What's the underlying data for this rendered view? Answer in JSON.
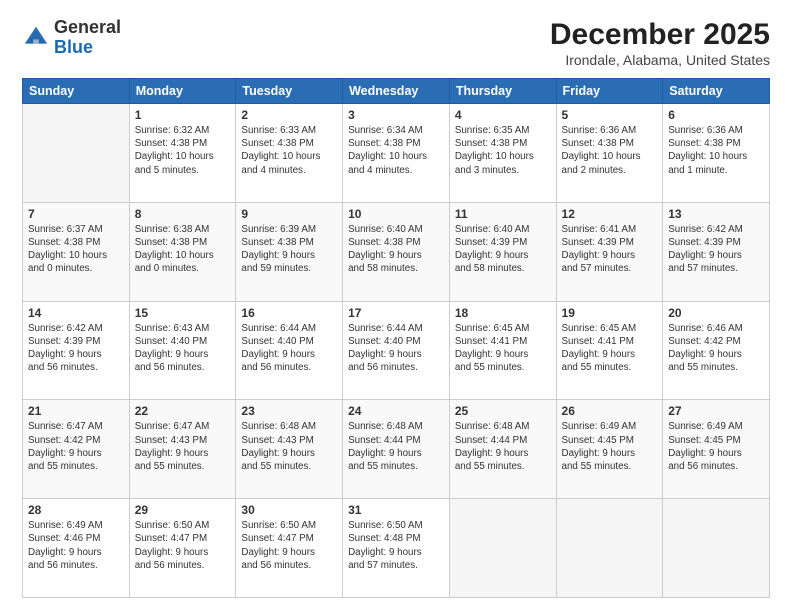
{
  "header": {
    "logo_general": "General",
    "logo_blue": "Blue",
    "title": "December 2025",
    "subtitle": "Irondale, Alabama, United States"
  },
  "weekdays": [
    "Sunday",
    "Monday",
    "Tuesday",
    "Wednesday",
    "Thursday",
    "Friday",
    "Saturday"
  ],
  "weeks": [
    [
      {
        "day": "",
        "detail": ""
      },
      {
        "day": "1",
        "detail": "Sunrise: 6:32 AM\nSunset: 4:38 PM\nDaylight: 10 hours\nand 5 minutes."
      },
      {
        "day": "2",
        "detail": "Sunrise: 6:33 AM\nSunset: 4:38 PM\nDaylight: 10 hours\nand 4 minutes."
      },
      {
        "day": "3",
        "detail": "Sunrise: 6:34 AM\nSunset: 4:38 PM\nDaylight: 10 hours\nand 4 minutes."
      },
      {
        "day": "4",
        "detail": "Sunrise: 6:35 AM\nSunset: 4:38 PM\nDaylight: 10 hours\nand 3 minutes."
      },
      {
        "day": "5",
        "detail": "Sunrise: 6:36 AM\nSunset: 4:38 PM\nDaylight: 10 hours\nand 2 minutes."
      },
      {
        "day": "6",
        "detail": "Sunrise: 6:36 AM\nSunset: 4:38 PM\nDaylight: 10 hours\nand 1 minute."
      }
    ],
    [
      {
        "day": "7",
        "detail": "Sunrise: 6:37 AM\nSunset: 4:38 PM\nDaylight: 10 hours\nand 0 minutes."
      },
      {
        "day": "8",
        "detail": "Sunrise: 6:38 AM\nSunset: 4:38 PM\nDaylight: 10 hours\nand 0 minutes."
      },
      {
        "day": "9",
        "detail": "Sunrise: 6:39 AM\nSunset: 4:38 PM\nDaylight: 9 hours\nand 59 minutes."
      },
      {
        "day": "10",
        "detail": "Sunrise: 6:40 AM\nSunset: 4:38 PM\nDaylight: 9 hours\nand 58 minutes."
      },
      {
        "day": "11",
        "detail": "Sunrise: 6:40 AM\nSunset: 4:39 PM\nDaylight: 9 hours\nand 58 minutes."
      },
      {
        "day": "12",
        "detail": "Sunrise: 6:41 AM\nSunset: 4:39 PM\nDaylight: 9 hours\nand 57 minutes."
      },
      {
        "day": "13",
        "detail": "Sunrise: 6:42 AM\nSunset: 4:39 PM\nDaylight: 9 hours\nand 57 minutes."
      }
    ],
    [
      {
        "day": "14",
        "detail": "Sunrise: 6:42 AM\nSunset: 4:39 PM\nDaylight: 9 hours\nand 56 minutes."
      },
      {
        "day": "15",
        "detail": "Sunrise: 6:43 AM\nSunset: 4:40 PM\nDaylight: 9 hours\nand 56 minutes."
      },
      {
        "day": "16",
        "detail": "Sunrise: 6:44 AM\nSunset: 4:40 PM\nDaylight: 9 hours\nand 56 minutes."
      },
      {
        "day": "17",
        "detail": "Sunrise: 6:44 AM\nSunset: 4:40 PM\nDaylight: 9 hours\nand 56 minutes."
      },
      {
        "day": "18",
        "detail": "Sunrise: 6:45 AM\nSunset: 4:41 PM\nDaylight: 9 hours\nand 55 minutes."
      },
      {
        "day": "19",
        "detail": "Sunrise: 6:45 AM\nSunset: 4:41 PM\nDaylight: 9 hours\nand 55 minutes."
      },
      {
        "day": "20",
        "detail": "Sunrise: 6:46 AM\nSunset: 4:42 PM\nDaylight: 9 hours\nand 55 minutes."
      }
    ],
    [
      {
        "day": "21",
        "detail": "Sunrise: 6:47 AM\nSunset: 4:42 PM\nDaylight: 9 hours\nand 55 minutes."
      },
      {
        "day": "22",
        "detail": "Sunrise: 6:47 AM\nSunset: 4:43 PM\nDaylight: 9 hours\nand 55 minutes."
      },
      {
        "day": "23",
        "detail": "Sunrise: 6:48 AM\nSunset: 4:43 PM\nDaylight: 9 hours\nand 55 minutes."
      },
      {
        "day": "24",
        "detail": "Sunrise: 6:48 AM\nSunset: 4:44 PM\nDaylight: 9 hours\nand 55 minutes."
      },
      {
        "day": "25",
        "detail": "Sunrise: 6:48 AM\nSunset: 4:44 PM\nDaylight: 9 hours\nand 55 minutes."
      },
      {
        "day": "26",
        "detail": "Sunrise: 6:49 AM\nSunset: 4:45 PM\nDaylight: 9 hours\nand 55 minutes."
      },
      {
        "day": "27",
        "detail": "Sunrise: 6:49 AM\nSunset: 4:45 PM\nDaylight: 9 hours\nand 56 minutes."
      }
    ],
    [
      {
        "day": "28",
        "detail": "Sunrise: 6:49 AM\nSunset: 4:46 PM\nDaylight: 9 hours\nand 56 minutes."
      },
      {
        "day": "29",
        "detail": "Sunrise: 6:50 AM\nSunset: 4:47 PM\nDaylight: 9 hours\nand 56 minutes."
      },
      {
        "day": "30",
        "detail": "Sunrise: 6:50 AM\nSunset: 4:47 PM\nDaylight: 9 hours\nand 56 minutes."
      },
      {
        "day": "31",
        "detail": "Sunrise: 6:50 AM\nSunset: 4:48 PM\nDaylight: 9 hours\nand 57 minutes."
      },
      {
        "day": "",
        "detail": ""
      },
      {
        "day": "",
        "detail": ""
      },
      {
        "day": "",
        "detail": ""
      }
    ]
  ]
}
